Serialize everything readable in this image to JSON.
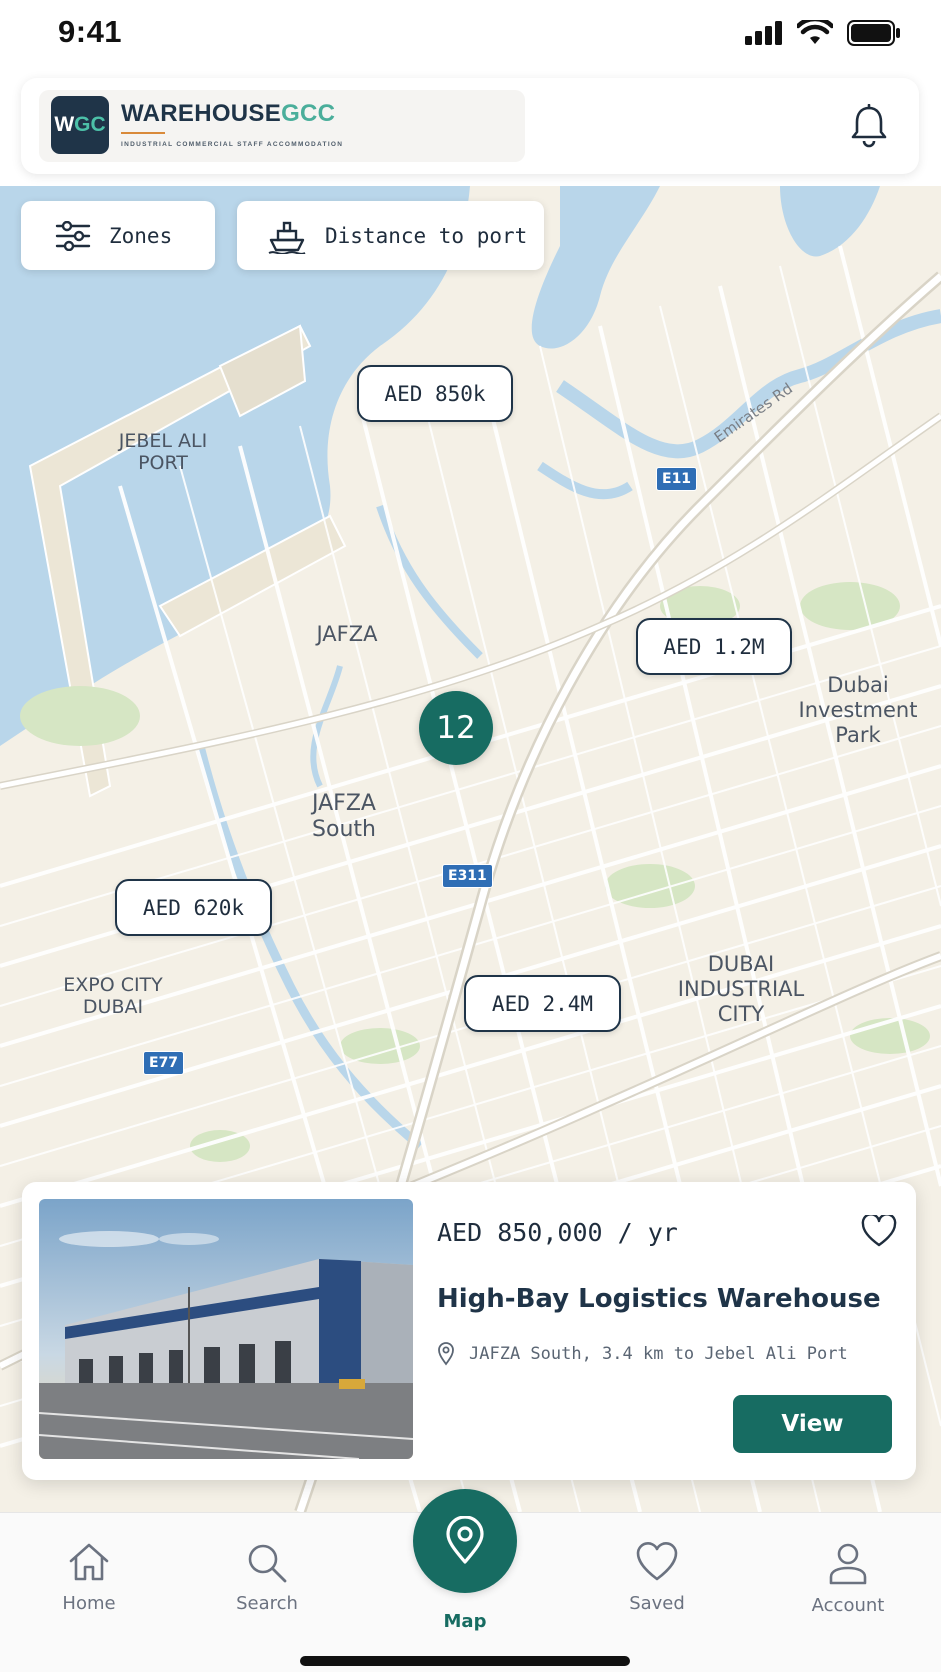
{
  "status_bar": {
    "time": "9:41"
  },
  "header": {
    "logo_mark_left": "W",
    "logo_mark_right": "GC",
    "brand_primary": "WAREHOUSE",
    "brand_accent": "GCC",
    "tagline": "INDUSTRIAL COMMERCIAL STAFF ACCOMMODATION",
    "icons": {
      "notifications": "bell-icon"
    }
  },
  "filters": {
    "zones_label": "Zones",
    "distance_label": "Distance to port",
    "icons": {
      "zones": "sliders-icon",
      "distance": "ship-icon"
    }
  },
  "map": {
    "pins": [
      "AED 850k",
      "AED 1.2M",
      "AED 620k",
      "AED 2.4M"
    ],
    "cluster_count": "12",
    "labels": {
      "jebel_ali_port_1": "JEBEL ALI",
      "jebel_ali_port_2": "PORT",
      "jafza": "JAFZA",
      "jafza_south_1": "JAFZA",
      "jafza_south_2": "South",
      "dip_1": "Dubai",
      "dip_2": "Investment",
      "dip_3": "Park",
      "expo_1": "EXPO CITY",
      "expo_2": "DUBAI",
      "dic_1": "DUBAI",
      "dic_2": "INDUSTRIAL",
      "dic_3": "CITY"
    },
    "roads": {
      "e11": "E11",
      "e311": "E311",
      "e77": "E77",
      "emirates_rd": "Emirates Rd"
    },
    "colors": {
      "water": "#b9d6ea",
      "land": "#f4f0e6",
      "green": "#d6e6c4",
      "road": "#ffffff"
    }
  },
  "listing": {
    "price": "AED 850,000 / yr",
    "title": "High-Bay Logistics Warehouse",
    "location": "JAFZA South, 3.4 km to Jebel Ali Port",
    "view_label": "View",
    "icons": {
      "favorite": "heart-icon",
      "location": "map-pin-icon"
    }
  },
  "nav": {
    "home": "Home",
    "search": "Search",
    "map": "Map",
    "saved": "Saved",
    "account": "Account",
    "active": "Map"
  },
  "colors": {
    "primary": "#176c62",
    "navy": "#1f3448",
    "accent": "#4aae9b"
  }
}
